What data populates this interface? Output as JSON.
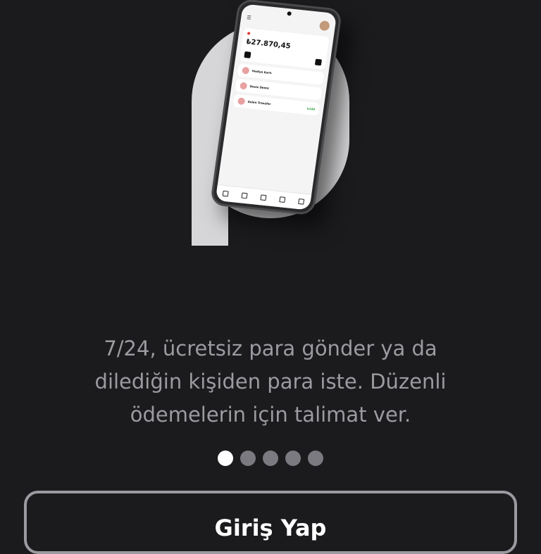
{
  "phone_mockup": {
    "balance": "₺27.870,45",
    "items": [
      {
        "title": "Hediye Kartı"
      },
      {
        "title": "Deniz Demir"
      },
      {
        "title": "Gelen Transfer",
        "amount": "₺100"
      }
    ]
  },
  "onboarding": {
    "description_lines": [
      "7/24, ücretsiz para gönder ya da",
      "dilediğin kişiden para iste. Düzenli",
      "ödemelerin için talimat ver."
    ],
    "page_indicator": {
      "current": 1,
      "total": 5
    }
  },
  "actions": {
    "login_label": "Giriş Yap"
  },
  "colors": {
    "background": "#1b1b1e",
    "text_muted": "#9b9ba0",
    "dot_active": "#ffffff",
    "dot_inactive": "#7a7a80",
    "button_border": "#9a9aa0"
  }
}
